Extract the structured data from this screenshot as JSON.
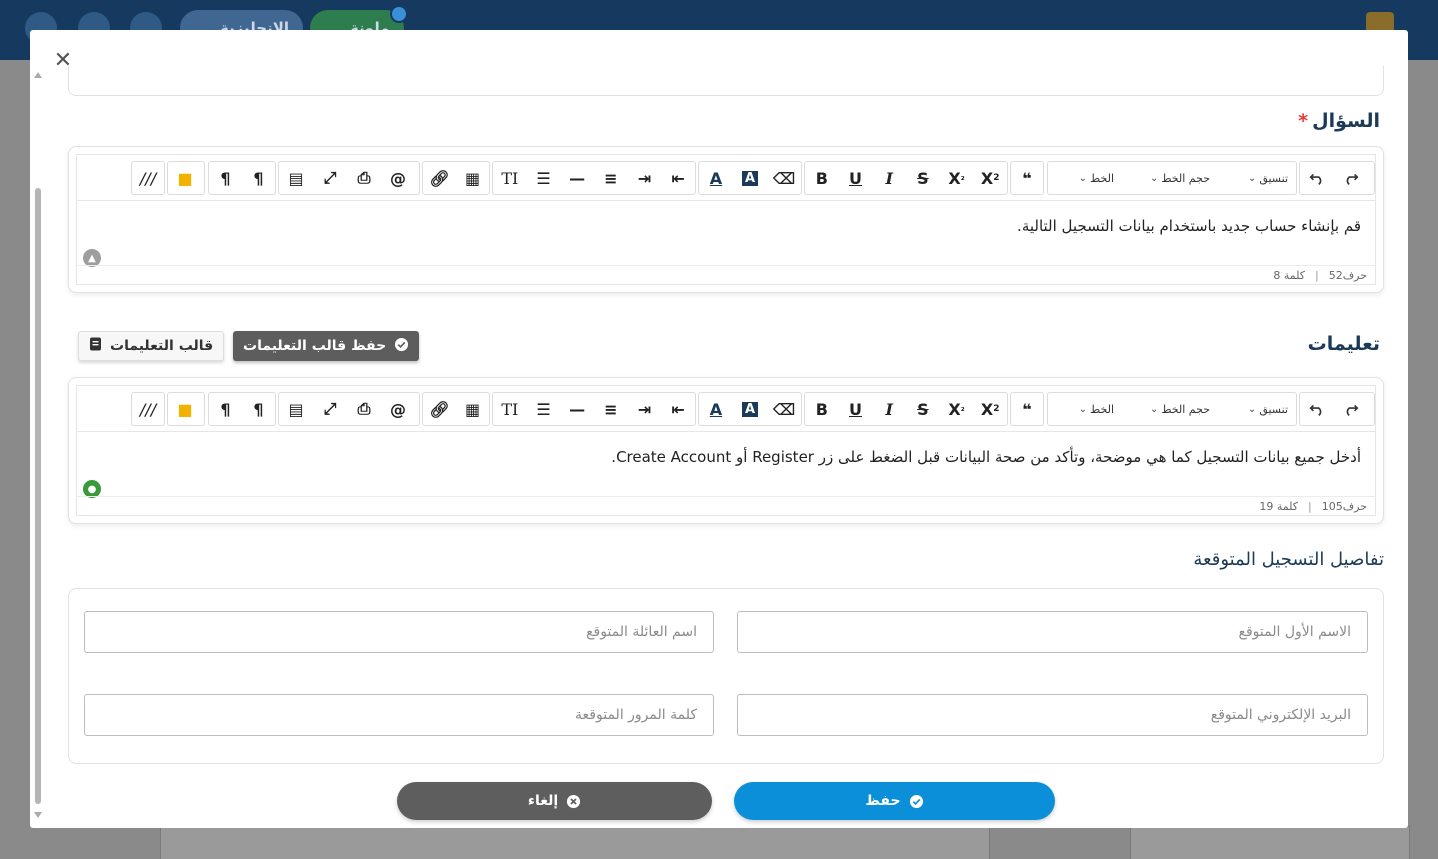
{
  "background": {
    "nav_pill_1": "الإنجليزية",
    "nav_pill_2": "ملونة"
  },
  "question": {
    "label": "السؤال",
    "required_mark": "*",
    "text": "قم بإنشاء حساب جديد باستخدام بيانات التسجيل التالية.",
    "char_count": "حرف52",
    "word_count": "كلمة 8"
  },
  "instructions": {
    "label": "تعليمات",
    "save_template_label": "حفظ قالب التعليمات",
    "template_label": "قالب التعليمات",
    "text": "أدخل جميع بيانات التسجيل كما هي موضحة، وتأكد من صحة البيانات قبل الضغط على زر Register أو Create Account.",
    "char_count": "حرف105",
    "word_count": "كلمة 19"
  },
  "toolbar": {
    "format_label": "تنسيق",
    "font_size_label": "حجم الخط",
    "font_label": "الخط"
  },
  "registration": {
    "title": "تفاصيل التسجيل المتوقعة",
    "first_name_placeholder": "الاسم الأول المتوقع",
    "last_name_placeholder": "اسم العائلة المتوقع",
    "email_placeholder": "البريد الإلكتروني المتوقع",
    "password_placeholder": "كلمة المرور المتوقعة"
  },
  "actions": {
    "save_label": "حفظ",
    "cancel_label": "إلغاء"
  },
  "colors": {
    "primary": "#0a8fd8",
    "dark_button": "#5e5e5e",
    "heading": "#1b3a57",
    "required": "#e53935"
  }
}
